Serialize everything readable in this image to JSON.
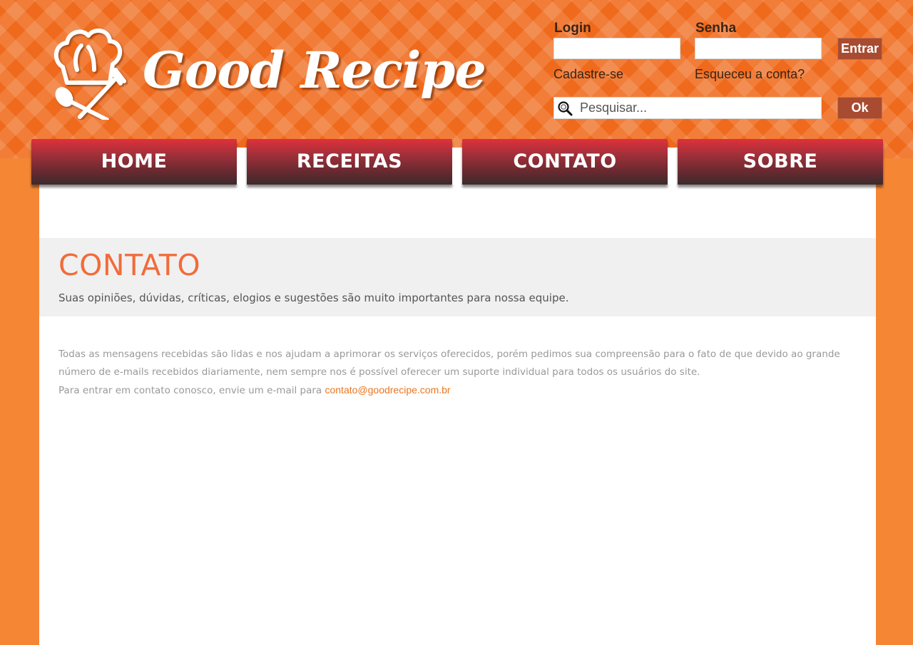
{
  "brand": {
    "name": "Good Recipe"
  },
  "login": {
    "login_label": "Login",
    "senha_label": "Senha",
    "login_value": "",
    "senha_value": "",
    "submit_label": "Entrar",
    "signup_link": "Cadastre-se",
    "forgot_link": "Esqueceu a conta?"
  },
  "search": {
    "placeholder": "Pesquisar...",
    "button_label": "Ok"
  },
  "nav": {
    "items": [
      {
        "label": "HOME"
      },
      {
        "label": "RECEITAS"
      },
      {
        "label": "CONTATO"
      },
      {
        "label": "SOBRE"
      }
    ]
  },
  "page": {
    "title": "CONTATO",
    "subtitle": "Suas opiniões, dúvidas, críticas, elogios e sugestões são muito importantes para nossa equipe.",
    "paragraph_1": "Todas as mensagens recebidas são lidas e nos ajudam a aprimorar os serviços oferecidos, porém pedimos sua compreensão para o fato de que devido ao grande número de e-mails recebidos diariamente, nem sempre nos é possível oferecer um suporte individual para todos os usuários do site.",
    "paragraph_2_prefix": "Para entrar em contato conosco, envie um e-mail para ",
    "email": "contato@goodrecipe.com.br"
  },
  "colors": {
    "header_orange": "#ef6a1c",
    "page_orange": "#f58634",
    "nav_red": "#e0303a",
    "title_orange": "#f26b3a",
    "link_orange": "#e87722",
    "button_brown": "#a84b30"
  },
  "icons": {
    "logo": "chef-hat-spoon-fork-icon",
    "search": "magnifier-icon"
  }
}
